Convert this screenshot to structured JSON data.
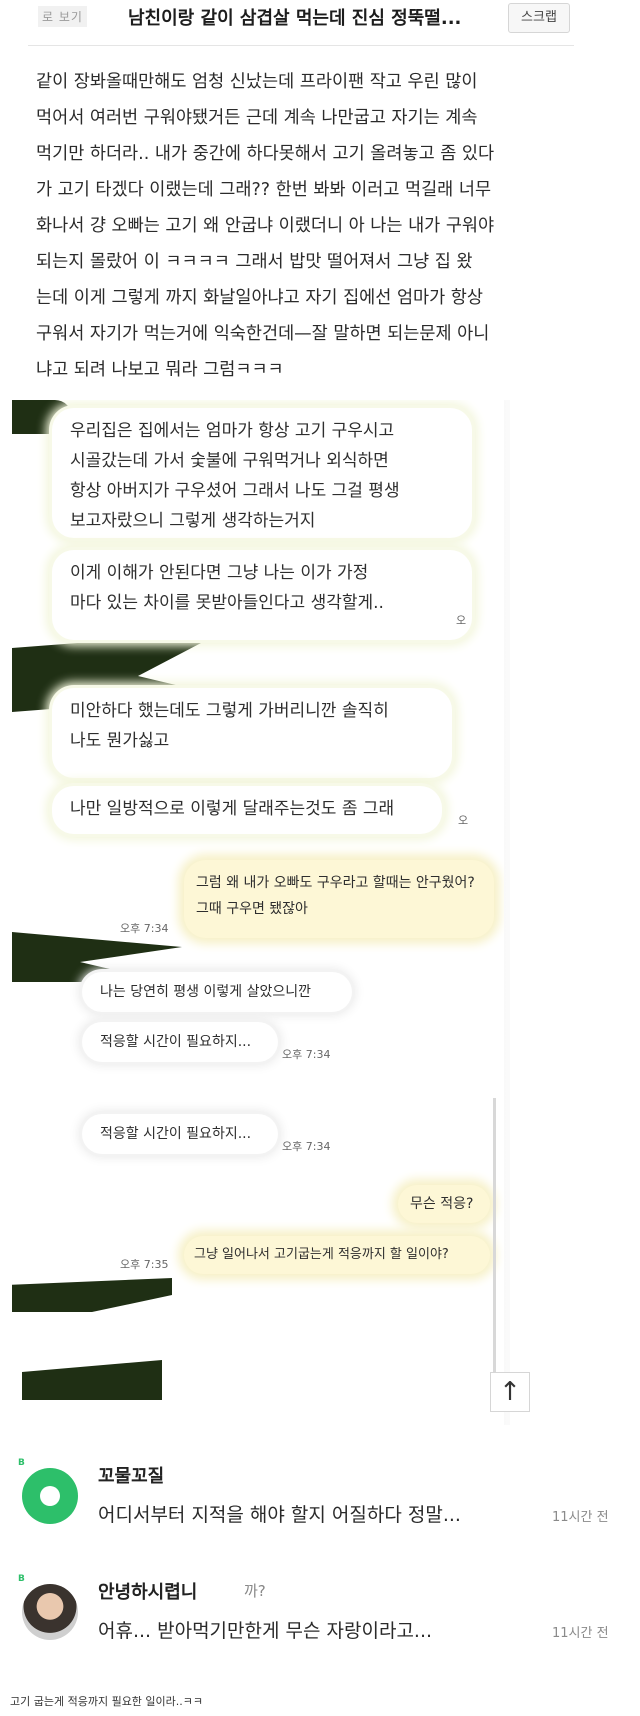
{
  "post": {
    "tag": "로 보기",
    "title": "남친이랑 같이 삼겹살 먹는데 진심 정뚝떨...",
    "scrap_label": "스크랩",
    "body": "같이 장봐올때만해도 엄청 신났는데 프라이팬 작고 우린 많이\n먹어서 여러번 구워야됐거든 근데 계속 나만굽고 자기는 계속\n먹기만 하더라.. 내가 중간에 하다못해서 고기 올려놓고 좀 있다\n가 고기 타겠다 이랬는데 그래?? 한번 봐봐 이러고 먹길래 너무\n화나서 걍 오빠는 고기 왜 안굽냐 이랬더니 아 나는 내가 구워야\n되는지 몰랐어 이    ㅋㅋㅋㅋ 그래서 밥맛 떨어져서 그냥 집 왔\n는데 이게 그렇게 까지 화날일아냐고 자기 집에선 엄마가 항상\n구워서 자기가 먹는거에 익숙한건데—잘 말하면 되는문제 아니\n냐고 되려 나보고 뭐라 그럼ㅋㅋㅋ"
  },
  "chat": {
    "messages": [
      {
        "text": "우리집은 집에서는 엄마가 항상 고기 구우시고\n시골갔는데 가서 숯불에 구워먹거나 외식하면\n항상 아버지가 구우셨어 그래서 나도 그걸 평생\n보고자랐으니 그렇게 생각하는거지"
      },
      {
        "text": "이게 이해가 안된다면 그냥 나는        이가 가정\n마다 있는 차이를 못받아들인다고 생각할게.."
      },
      {
        "text": "미안하다 했는데도 그렇게 가버리니깐 솔직히\n나도 뭔가싫고"
      },
      {
        "text": "나만 일방적으로 이렇게 달래주는것도 좀 그래"
      },
      {
        "text": "그럼 왜 내가 오빠도 구우라고 할때는 안구웠어?\n그때 구우면 됐잖아"
      },
      {
        "text": "나는 당연히 평생 이렇게 살았으니깐"
      },
      {
        "text": "적응할 시간이 필요하지..."
      },
      {
        "text": "적응할 시간이 필요하지..."
      },
      {
        "text": "무슨 적응?"
      },
      {
        "text": "그냥 일어나서 고기굽는게 적응까지 할 일이야?"
      }
    ],
    "times": {
      "t1": "오후 7:34",
      "t2": "오후 7:34",
      "t3": "오후 7:34",
      "t4": "오후 7:35"
    },
    "read_marks": [
      "오",
      "오"
    ],
    "scroll_up_icon": "↑"
  },
  "comments": [
    {
      "badge": "B",
      "name": "꼬물꼬질",
      "extra": "",
      "text": "어디서부터 지적을 해야 할지 어질하다 정말...",
      "time": "11시간 전",
      "avatar": "green-circle-avatar"
    },
    {
      "badge": "B",
      "name": "안녕하시렵니",
      "extra": "까?",
      "text": "어휴... 받아먹기만한게 무슨 자랑이라고...",
      "time": "11시간 전",
      "avatar": "photo-avatar"
    }
  ],
  "caption": "고기 굽는게 적응까지 필요한 일이라..ㅋㅋ"
}
